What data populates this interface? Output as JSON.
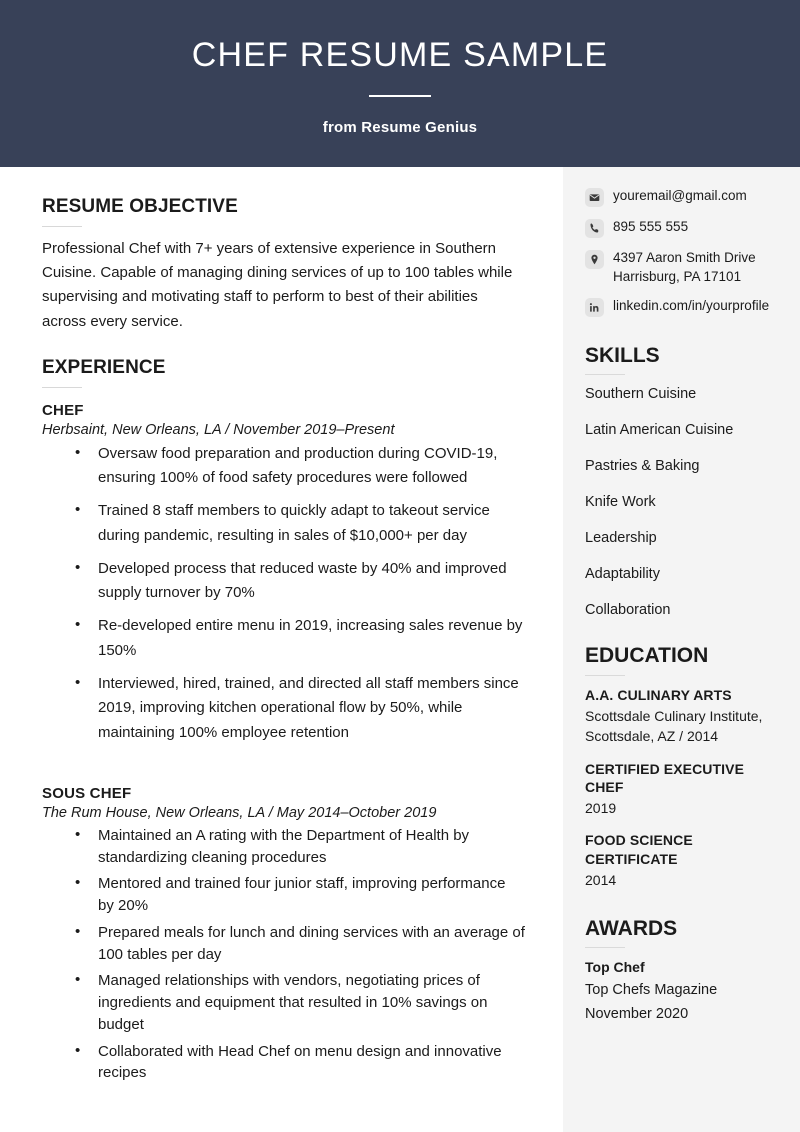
{
  "header": {
    "title": "CHEF RESUME SAMPLE",
    "subtitle": "from Resume Genius",
    "background_color": "#384158",
    "text_color": "#ffffff"
  },
  "main": {
    "objective": {
      "heading": "RESUME OBJECTIVE",
      "text": "Professional Chef with 7+ years of extensive experience in Southern Cuisine. Capable of managing dining services of up to 100 tables while supervising and motivating staff to perform to best of their abilities across every service."
    },
    "experience": {
      "heading": "EXPERIENCE",
      "jobs": [
        {
          "title": "CHEF",
          "meta": "Herbsaint, New Orleans, LA  /  November 2019–Present",
          "bullets": [
            "Oversaw food preparation and production during COVID-19, ensuring 100% of food safety procedures were followed",
            "Trained 8 staff members to quickly adapt to takeout service during pandemic, resulting in sales of $10,000+ per day",
            "Developed process that reduced waste by 40% and improved supply turnover by 70%",
            "Re-developed entire menu in 2019, increasing sales revenue by 150%",
            "Interviewed, hired, trained, and directed all staff members since 2019, improving kitchen operational flow by 50%, while maintaining 100% employee retention"
          ]
        },
        {
          "title": "SOUS CHEF",
          "meta": "The Rum House, New Orleans, LA   /  May 2014–October 2019",
          "bullets": [
            "Maintained an A rating with the Department of Health by standardizing cleaning procedures",
            "Mentored and trained four junior staff, improving performance by 20%",
            "Prepared meals for lunch and dining services with an average of 100 tables per day",
            "Managed relationships with vendors, negotiating prices of ingredients and equipment that resulted in 10% savings on budget",
            "Collaborated with Head Chef on menu design and innovative recipes"
          ]
        }
      ]
    }
  },
  "sidebar": {
    "background_color": "#f4f4f4",
    "contact": [
      {
        "icon": "envelope-icon",
        "text": "youremail@gmail.com"
      },
      {
        "icon": "phone-icon",
        "text": "895 555 555"
      },
      {
        "icon": "location-pin-icon",
        "text": "4397 Aaron Smith Drive Harrisburg, PA 17101"
      },
      {
        "icon": "linkedin-icon",
        "text": "linkedin.com/in/yourprofile"
      }
    ],
    "skills": {
      "heading": "SKILLS",
      "items": [
        "Southern Cuisine",
        "Latin American Cuisine",
        "Pastries & Baking",
        "Knife Work",
        "Leadership",
        "Adaptability",
        "Collaboration"
      ]
    },
    "education": {
      "heading": "EDUCATION",
      "items": [
        {
          "degree": "A.A. CULINARY ARTS",
          "detail": "Scottsdale Culinary Institute, Scottsdale, AZ / 2014"
        },
        {
          "degree": "CERTIFIED EXECUTIVE CHEF",
          "detail": "2019"
        },
        {
          "degree": "FOOD SCIENCE CERTIFICATE",
          "detail": "2014"
        }
      ]
    },
    "awards": {
      "heading": "AWARDS",
      "items": [
        {
          "name": "Top Chef",
          "org": "Top Chefs Magazine",
          "date": "November 2020"
        }
      ]
    }
  }
}
